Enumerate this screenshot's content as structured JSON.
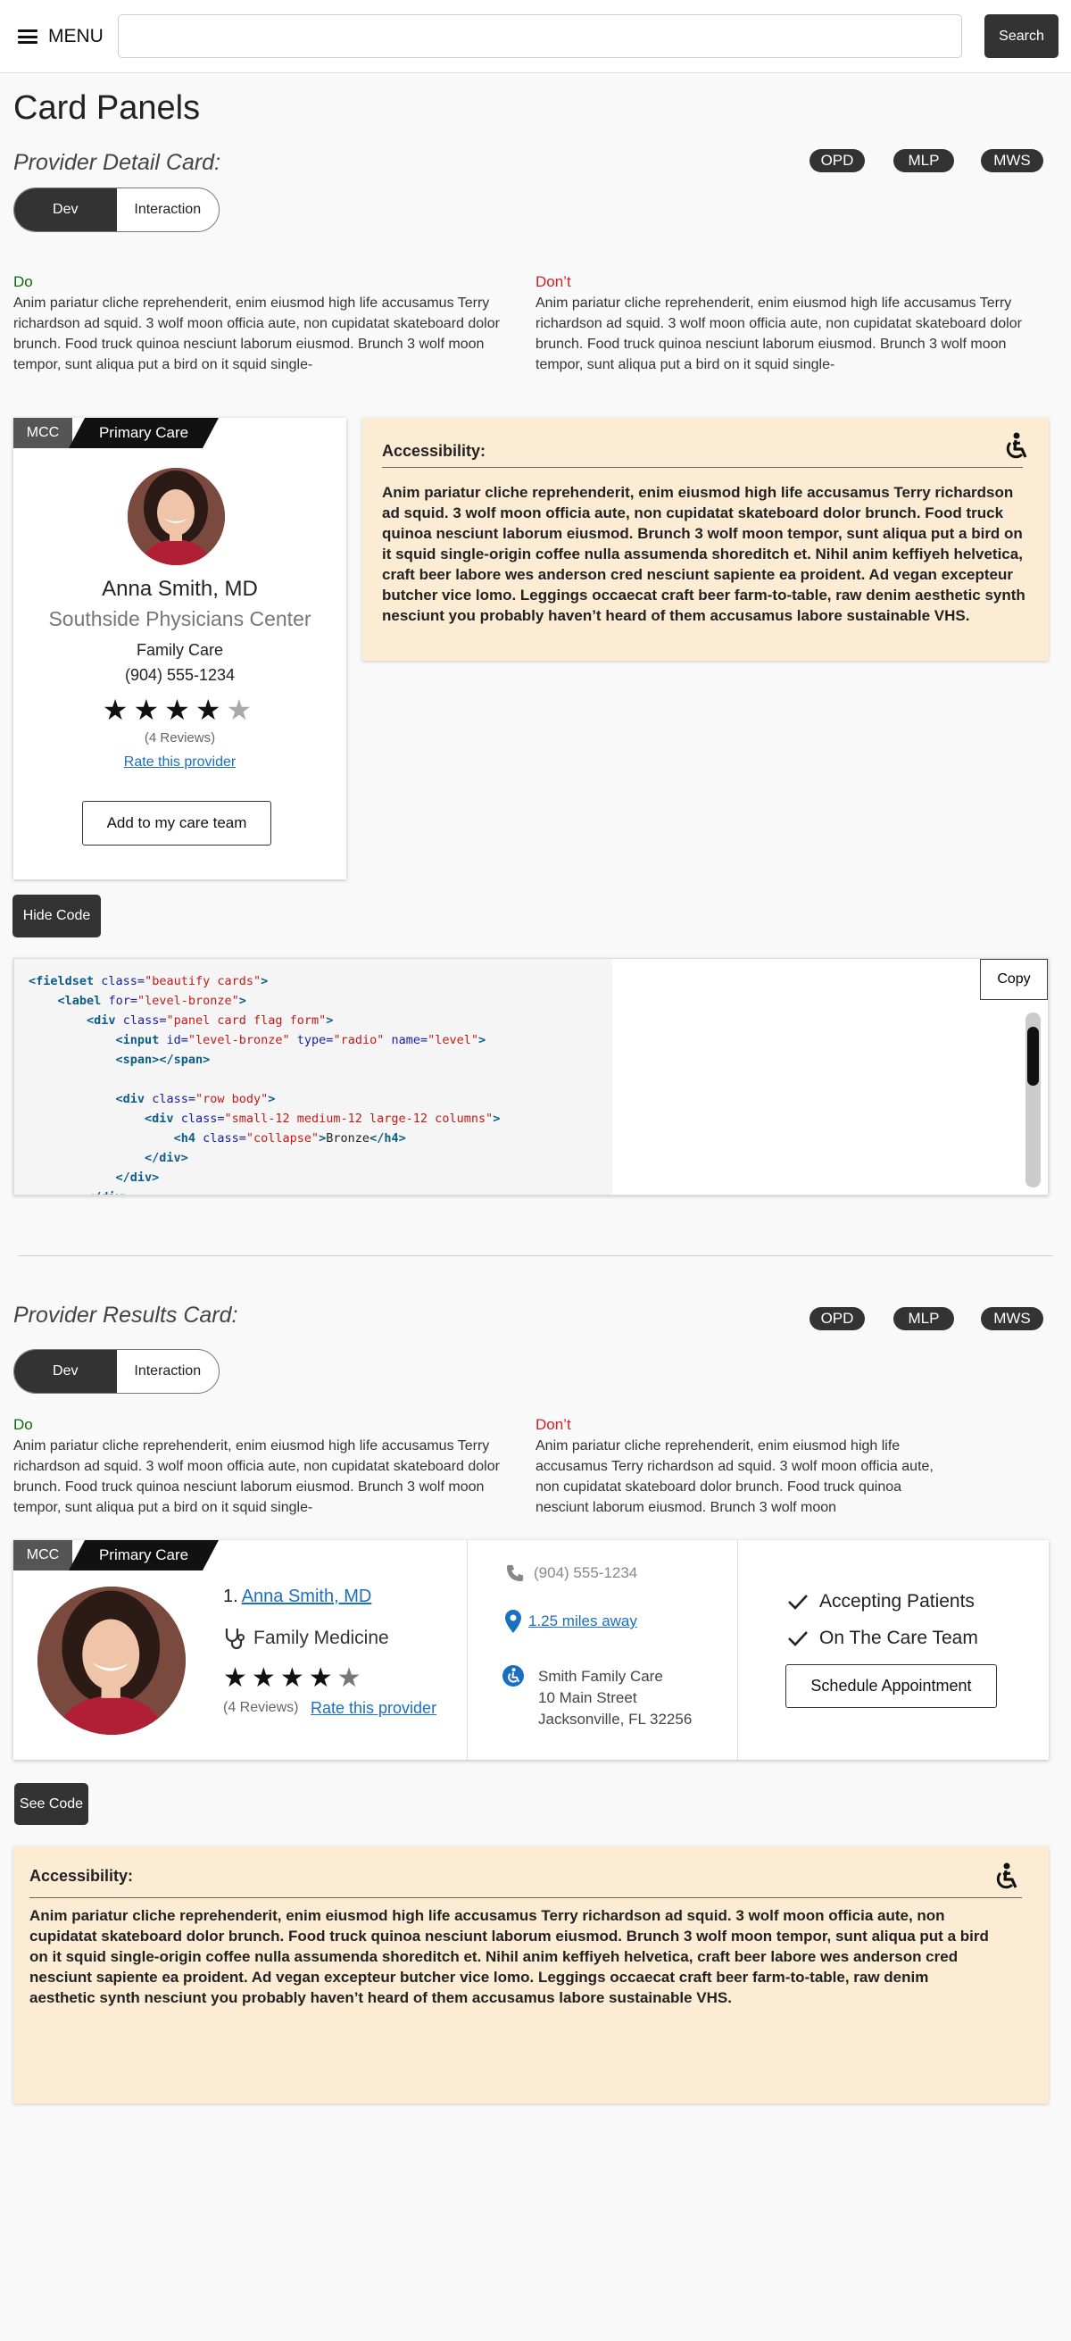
{
  "header": {
    "menu_label": "MENU",
    "search_placeholder": "",
    "search_button": "Search"
  },
  "page_title": "Card Panels",
  "detail_section": {
    "title": "Provider Detail Card:",
    "pills": [
      "OPD",
      "MLP",
      "MWS"
    ],
    "toggle": {
      "dev": "Dev",
      "interaction": "Interaction",
      "active": "Dev"
    },
    "do_label": "Do",
    "do_text": "Anim pariatur cliche reprehenderit, enim eiusmod high life accusamus Terry richardson ad squid. 3 wolf moon officia aute, non cupidatat skateboard dolor brunch. Food truck quinoa nesciunt laborum eiusmod. Brunch 3 wolf moon tempor, sunt aliqua put a bird on it squid single-",
    "dont_label": "Don’t",
    "dont_text": "Anim pariatur cliche reprehenderit, enim eiusmod high life accusamus Terry richardson ad squid. 3 wolf moon officia aute, non cupidatat skateboard dolor brunch. Food truck quinoa nesciunt laborum eiusmod. Brunch 3 wolf moon tempor, sunt aliqua put a bird on it squid single-",
    "card": {
      "flag_mcc": "MCC",
      "flag_primary": "Primary Care",
      "name": "Anna Smith, MD",
      "practice": "Southside Physicians Center",
      "specialty": "Family Care",
      "phone": "(904) 555-1234",
      "rating": 4,
      "rating_max": 5,
      "reviews": "(4 Reviews)",
      "rate_link": "Rate this provider",
      "add_button": "Add to my care team"
    },
    "accessibility": {
      "title": "Accessibility:",
      "text": "Anim pariatur cliche reprehenderit, enim eiusmod high life accusamus Terry richardson ad squid. 3 wolf moon officia aute, non cupidatat skateboard dolor brunch. Food truck quinoa nesciunt laborum eiusmod. Brunch 3 wolf moon tempor, sunt aliqua put a bird on it squid single-origin coffee nulla assumenda shoreditch et. Nihil anim keffiyeh helvetica, craft beer labore wes anderson cred nesciunt sapiente ea proident. Ad vegan excepteur butcher vice lomo. Leggings occaecat craft beer farm-to-table, raw denim aesthetic synth nesciunt you probably haven’t heard of them accusamus labore sustainable VHS."
    },
    "hide_code_button": "Hide Code",
    "copy_button": "Copy"
  },
  "results_section": {
    "title": "Provider Results Card:",
    "pills": [
      "OPD",
      "MLP",
      "MWS"
    ],
    "toggle": {
      "dev": "Dev",
      "interaction": "Interaction",
      "active": "Dev"
    },
    "do_label": "Do",
    "do_text": "Anim pariatur cliche reprehenderit, enim eiusmod high life accusamus Terry richardson ad squid. 3 wolf moon officia aute, non cupidatat skateboard dolor brunch. Food truck quinoa nesciunt laborum eiusmod. Brunch 3 wolf moon tempor, sunt aliqua put a bird on it squid single-",
    "dont_label": "Don’t",
    "dont_text": "Anim pariatur cliche reprehenderit, enim eiusmod high life accusamus Terry richardson ad squid. 3 wolf moon officia aute, non cupidatat skateboard dolor brunch. Food truck quinoa nesciunt laborum eiusmod. Brunch 3 wolf moon",
    "card": {
      "flag_mcc": "MCC",
      "flag_primary": "Primary Care",
      "number": "1.",
      "name": "Anna Smith, MD",
      "specialty": "Family Medicine",
      "rating": 4,
      "rating_max": 5,
      "reviews": "(4 Reviews)",
      "rate_link": "Rate this provider",
      "phone": "(904) 555-1234",
      "distance": "1.25 miles away",
      "location_name": "Smith Family Care",
      "address1": "10 Main Street",
      "address2": "Jacksonville, FL 32256",
      "accepting": "Accepting Patients",
      "on_team": "On The Care Team",
      "schedule_button": "Schedule Appointment"
    },
    "see_code_button": "See Code",
    "accessibility": {
      "title": "Accessibility:",
      "text": "Anim pariatur cliche reprehenderit, enim eiusmod high life accusamus Terry richardson ad squid. 3 wolf moon officia aute, non cupidatat skateboard dolor brunch. Food truck quinoa nesciunt laborum eiusmod. Brunch 3 wolf moon tempor, sunt aliqua put a bird on it squid single-origin coffee nulla assumenda shoreditch et. Nihil anim keffiyeh helvetica, craft beer labore wes anderson cred nesciunt sapiente ea proident. Ad vegan excepteur butcher vice lomo. Leggings occaecat craft beer farm-to-table, raw denim aesthetic synth nesciunt you probably haven’t heard of them accusamus labore sustainable VHS."
    }
  },
  "code_lines": [
    {
      "i": 0,
      "html": "<span class='tg'>&lt;fieldset</span> <span class='at'>class=</span><span class='vl'>\"beautify cards\"</span><span class='tg'>&gt;</span>"
    },
    {
      "i": 1,
      "html": "<span class='tg'>&lt;label</span> <span class='at'>for=</span><span class='vl'>\"level-bronze\"</span><span class='tg'>&gt;</span>"
    },
    {
      "i": 2,
      "html": "<span class='tg'>&lt;div</span> <span class='at'>class=</span><span class='vl'>\"panel card flag form\"</span><span class='tg'>&gt;</span>"
    },
    {
      "i": 3,
      "html": "<span class='tg'>&lt;input</span> <span class='at'>id=</span><span class='vl'>\"level-bronze\"</span> <span class='at'>type=</span><span class='vl'>\"radio\"</span> <span class='at'>name=</span><span class='vl'>\"level\"</span><span class='tg'>&gt;</span>"
    },
    {
      "i": 3,
      "html": "<span class='tg'>&lt;span&gt;&lt;/span&gt;</span>"
    },
    {
      "i": 0,
      "html": ""
    },
    {
      "i": 3,
      "html": "<span class='tg'>&lt;div</span> <span class='at'>class=</span><span class='vl'>\"row body\"</span><span class='tg'>&gt;</span>"
    },
    {
      "i": 4,
      "html": "<span class='tg'>&lt;div</span> <span class='at'>class=</span><span class='vl'>\"small-12 medium-12 large-12 columns\"</span><span class='tg'>&gt;</span>"
    },
    {
      "i": 5,
      "html": "<span class='tg'>&lt;h4</span> <span class='at'>class=</span><span class='vl'>\"collapse\"</span><span class='tg'>&gt;</span>Bronze<span class='tg'>&lt;/h4&gt;</span>"
    },
    {
      "i": 4,
      "html": "<span class='tg'>&lt;/div&gt;</span>"
    },
    {
      "i": 3,
      "html": "<span class='tg'>&lt;/div&gt;</span>"
    },
    {
      "i": 2,
      "html": "<span class='tg'>&lt;/div&gt;</span>"
    }
  ]
}
